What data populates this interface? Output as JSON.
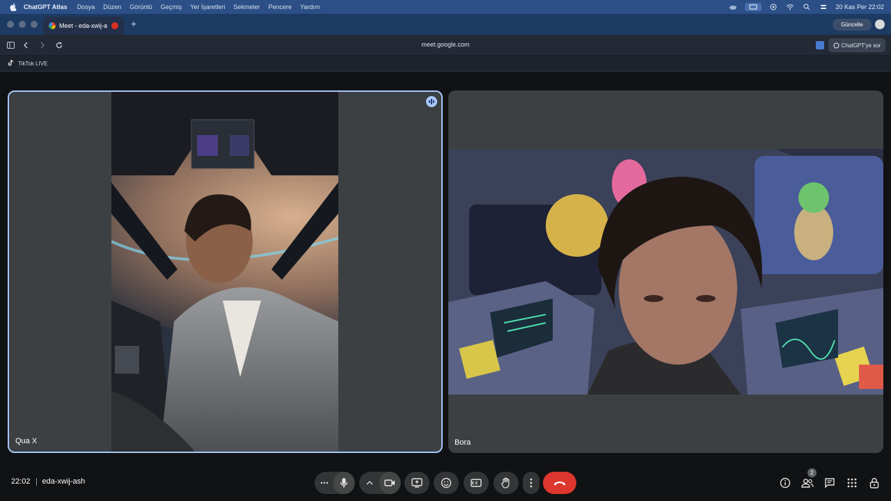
{
  "menubar": {
    "app": "ChatGPT Atlas",
    "items": [
      "Dosya",
      "Düzen",
      "Görüntü",
      "Geçmiş",
      "Yer İşaretleri",
      "Sekmeler",
      "Pencere",
      "Yardım"
    ],
    "datetime": "20 Kas Per  22:02"
  },
  "browser": {
    "tab_title": "Meet - eda-xwij-a",
    "update_label": "Güncelle",
    "url": "meet.google.com",
    "ask_label": "ChatGPT'ye sor",
    "bookmark": "TikTok LIVE"
  },
  "participants": [
    {
      "name": "Qua X"
    },
    {
      "name": "Bora"
    }
  ],
  "meeting": {
    "time": "22:02",
    "code": "eda-xwij-ash",
    "participant_count": "2"
  },
  "colors": {
    "accent": "#a8c7fa",
    "hangup": "#dc362e",
    "tile": "#3c4043",
    "control": "#333537"
  }
}
